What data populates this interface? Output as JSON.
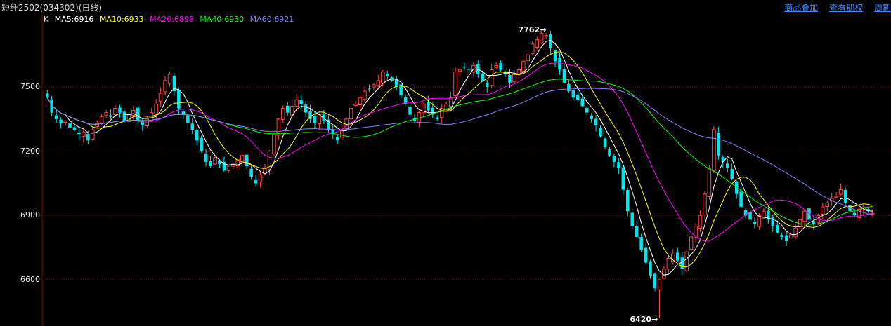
{
  "header": {
    "title": "短纤2502(034302)(日线)",
    "links": [
      "商品叠加",
      "查看期权",
      "周期"
    ]
  },
  "legend": {
    "k_label": "K",
    "items": [
      {
        "text": "MA5:6916",
        "color": "#ffffff"
      },
      {
        "text": "MA10:6933",
        "color": "#ffff00"
      },
      {
        "text": "MA20:6898",
        "color": "#ff00ff"
      },
      {
        "text": "MA40:6930",
        "color": "#00ff00"
      },
      {
        "text": "MA60:6921",
        "color": "#8080ff"
      }
    ]
  },
  "annotations": {
    "high": "7762",
    "low": "6420"
  },
  "colors": {
    "up": "#ff4444",
    "down": "#00e5ee",
    "grid": "#8b0000",
    "axis": "#8b0000"
  },
  "chart_data": {
    "type": "candlestick",
    "yticks": [
      7500,
      7200,
      6900,
      6600
    ],
    "ylim": [
      6350,
      7870
    ],
    "high_point": 7762,
    "low_point": 6420,
    "ma_periods": [
      5,
      10,
      20,
      40,
      60
    ],
    "closes": [
      7450,
      7380,
      7350,
      7330,
      7340,
      7310,
      7300,
      7280,
      7290,
      7250,
      7300,
      7330,
      7360,
      7380,
      7360,
      7400,
      7380,
      7340,
      7370,
      7390,
      7340,
      7320,
      7350,
      7380,
      7420,
      7470,
      7530,
      7560,
      7480,
      7400,
      7370,
      7330,
      7300,
      7250,
      7200,
      7150,
      7130,
      7170,
      7140,
      7110,
      7130,
      7140,
      7160,
      7180,
      7130,
      7080,
      7050,
      7090,
      7120,
      7200,
      7280,
      7350,
      7400,
      7380,
      7410,
      7440,
      7420,
      7380,
      7350,
      7330,
      7370,
      7340,
      7300,
      7280,
      7250,
      7300,
      7350,
      7400,
      7420,
      7450,
      7480,
      7490,
      7510,
      7530,
      7570,
      7550,
      7530,
      7500,
      7460,
      7420,
      7370,
      7340,
      7380,
      7420,
      7390,
      7370,
      7350,
      7400,
      7420,
      7450,
      7570,
      7580,
      7590,
      7580,
      7600,
      7560,
      7530,
      7500,
      7580,
      7600,
      7580,
      7560,
      7520,
      7560,
      7580,
      7620,
      7650,
      7700,
      7720,
      7750,
      7740,
      7680,
      7620,
      7580,
      7520,
      7480,
      7450,
      7440,
      7410,
      7380,
      7350,
      7320,
      7270,
      7220,
      7180,
      7150,
      7120,
      7020,
      6920,
      6850,
      6800,
      6740,
      6680,
      6620,
      6560,
      6600,
      6650,
      6700,
      6720,
      6690,
      6650,
      6730,
      6800,
      6850,
      6900,
      7000,
      7120,
      7300,
      7180,
      7150,
      7120,
      7070,
      7000,
      6940,
      6900,
      6880,
      6860,
      6900,
      6920,
      6880,
      6850,
      6820,
      6800,
      6780,
      6810,
      6840,
      6880,
      6920,
      6880,
      6860,
      6900,
      6940,
      6960,
      6980,
      6990,
      7020,
      6960,
      6920,
      6900,
      6930,
      6940,
      6920,
      6910
    ]
  }
}
